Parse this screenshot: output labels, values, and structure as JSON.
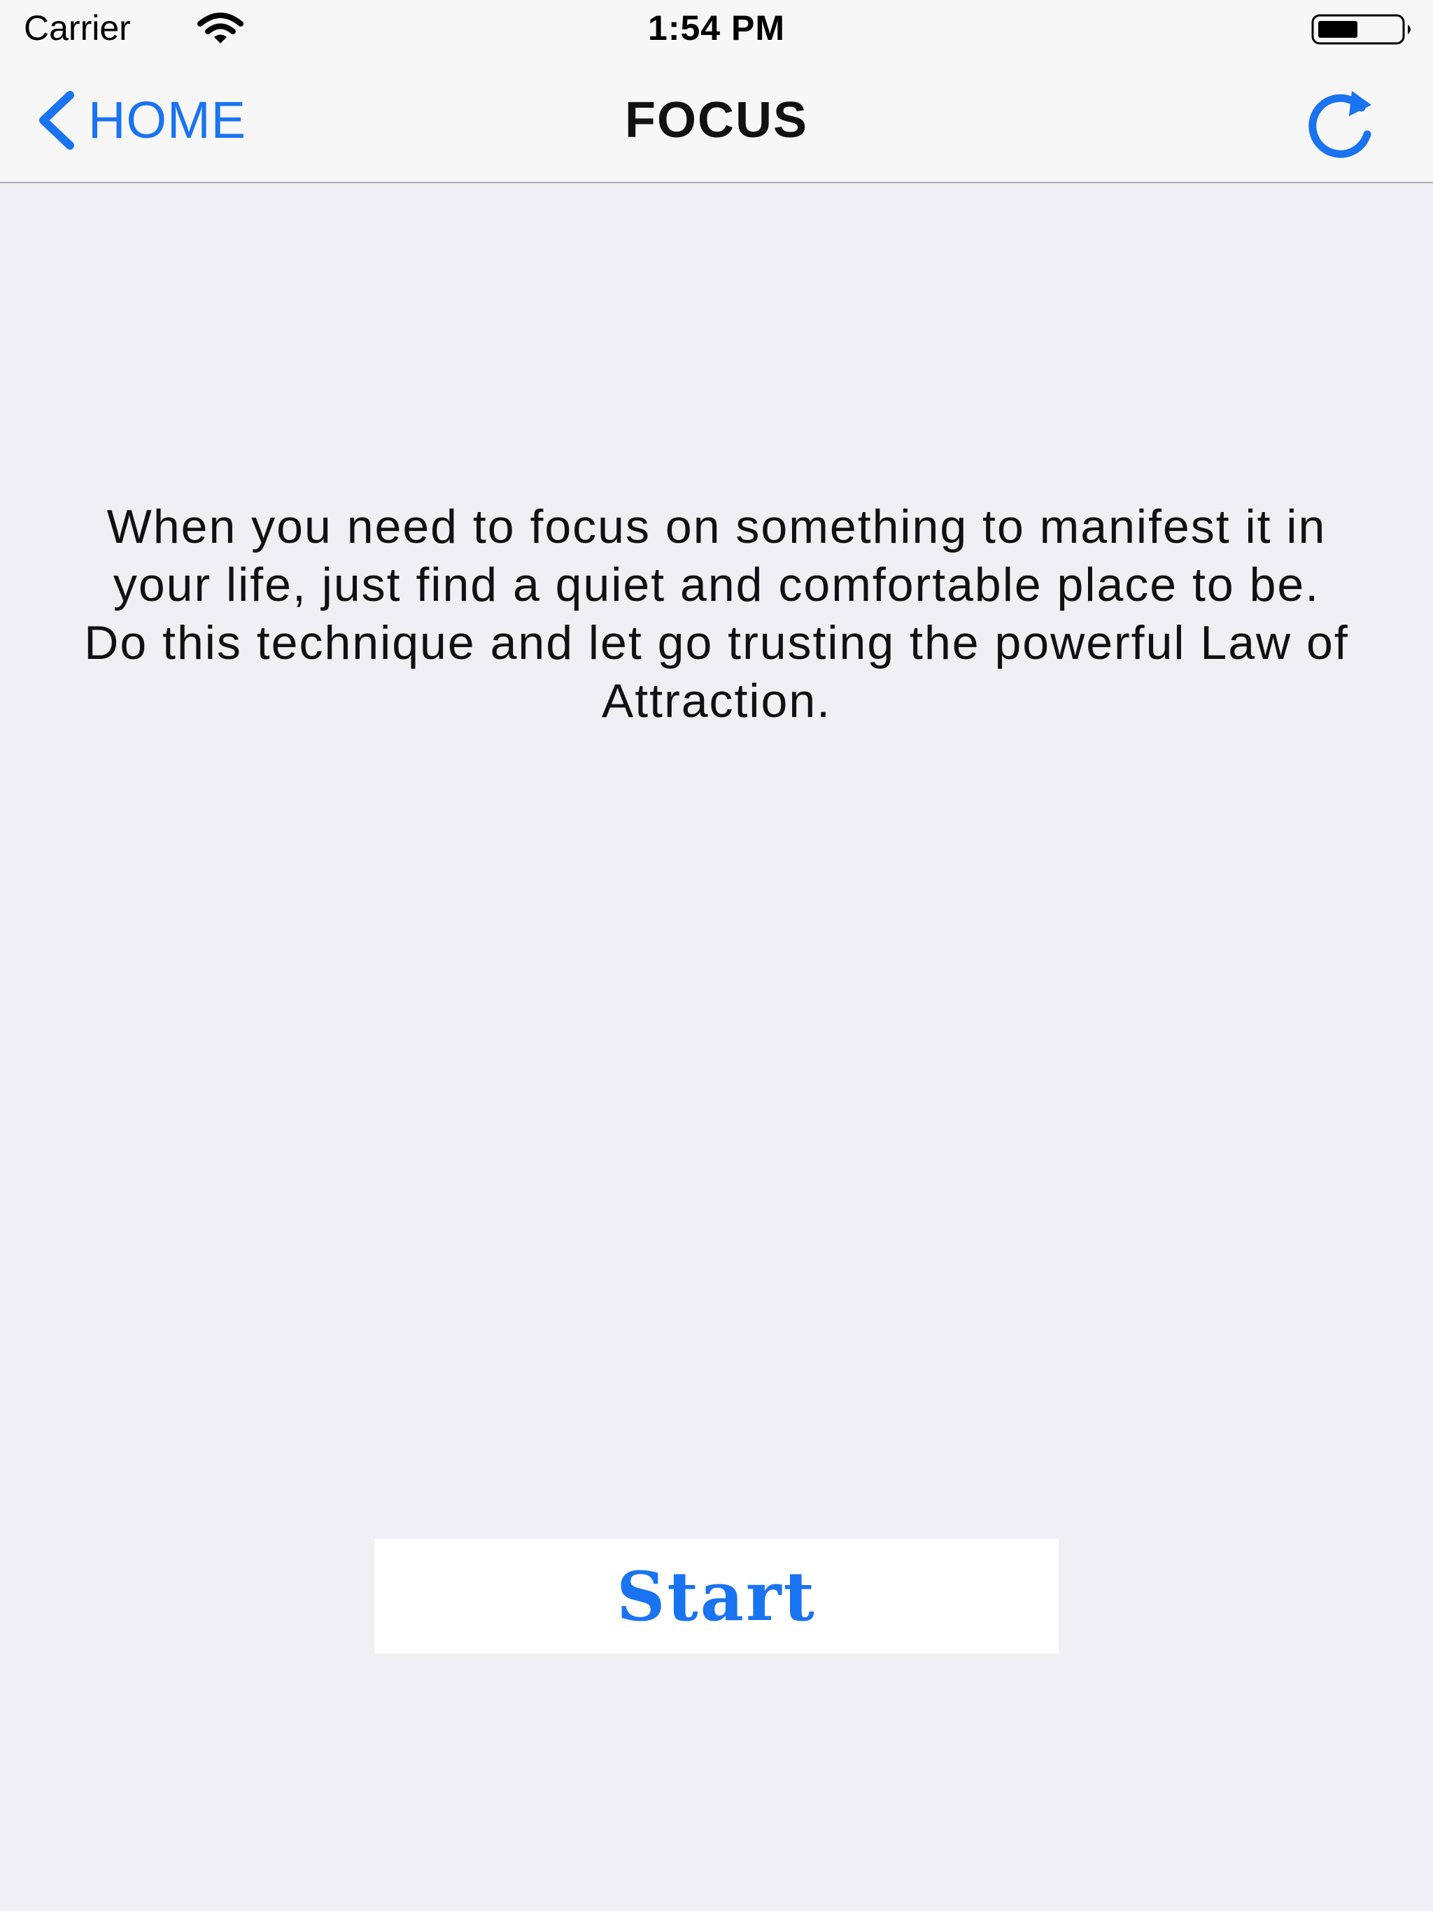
{
  "status_bar": {
    "carrier": "Carrier",
    "time": "1:54 PM"
  },
  "nav": {
    "back_label": "HOME",
    "title": "FOCUS",
    "back_icon": "chevron-left-icon",
    "refresh_icon": "refresh-icon"
  },
  "content": {
    "description": "When you need to focus on something to manifest it in your life, just find a quiet and comfortable place to be. Do this technique and let go trusting the powerful Law of Attraction.",
    "start_label": "Start"
  },
  "colors": {
    "accent": "#1a73f0",
    "background": "#efeff4",
    "bar": "#f7f7f7",
    "text": "#111111"
  }
}
